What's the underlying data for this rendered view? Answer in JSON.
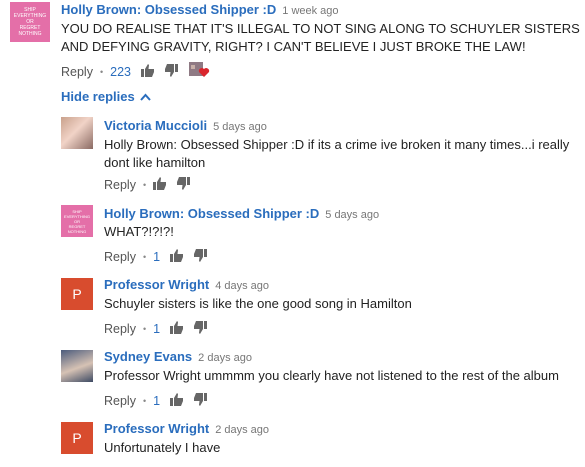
{
  "avatar_text": [
    "Ship",
    "Everything",
    "or",
    "Regret",
    "Nothing"
  ],
  "top": {
    "author": "Holly Brown: Obsessed Shipper :D",
    "time": "1 week ago",
    "text": "YOU DO REALISE THAT IT'S ILLEGAL TO NOT SING ALONG TO SCHUYLER SISTERS AND DEFYING GRAVITY, RIGHT? I CAN'T BELIEVE I JUST BROKE THE LAW!",
    "reply_label": "Reply",
    "likes": "223"
  },
  "hide_replies_label": "Hide replies",
  "replies": [
    {
      "author": "Victoria Muccioli",
      "time": "5 days ago",
      "text": "Holly Brown: Obsessed Shipper :D if its a crime ive broken it many times...i really dont like hamilton",
      "reply_label": "Reply",
      "likes": ""
    },
    {
      "author": "Holly Brown: Obsessed Shipper :D",
      "time": "5 days ago",
      "text": "WHAT?!?!?!",
      "reply_label": "Reply",
      "likes": "1"
    },
    {
      "author": "Professor Wright",
      "time": "4 days ago",
      "text": "Schuyler sisters is like the one good song in Hamilton",
      "reply_label": "Reply",
      "likes": "1",
      "initial": "P"
    },
    {
      "author": "Sydney Evans",
      "time": "2 days ago",
      "text": "Professor Wright ummmm you clearly have not listened to the rest of the album",
      "reply_label": "Reply",
      "likes": "1"
    },
    {
      "author": "Professor Wright",
      "time": "2 days ago",
      "text": "Unfortunately I have",
      "reply_label": "Reply",
      "likes": "",
      "initial": "P"
    }
  ],
  "colors": {
    "link": "#2a6dbd",
    "avatar_pink": "#e46fa8",
    "avatar_red": "#d84c2e",
    "heart": "#d9262d"
  }
}
